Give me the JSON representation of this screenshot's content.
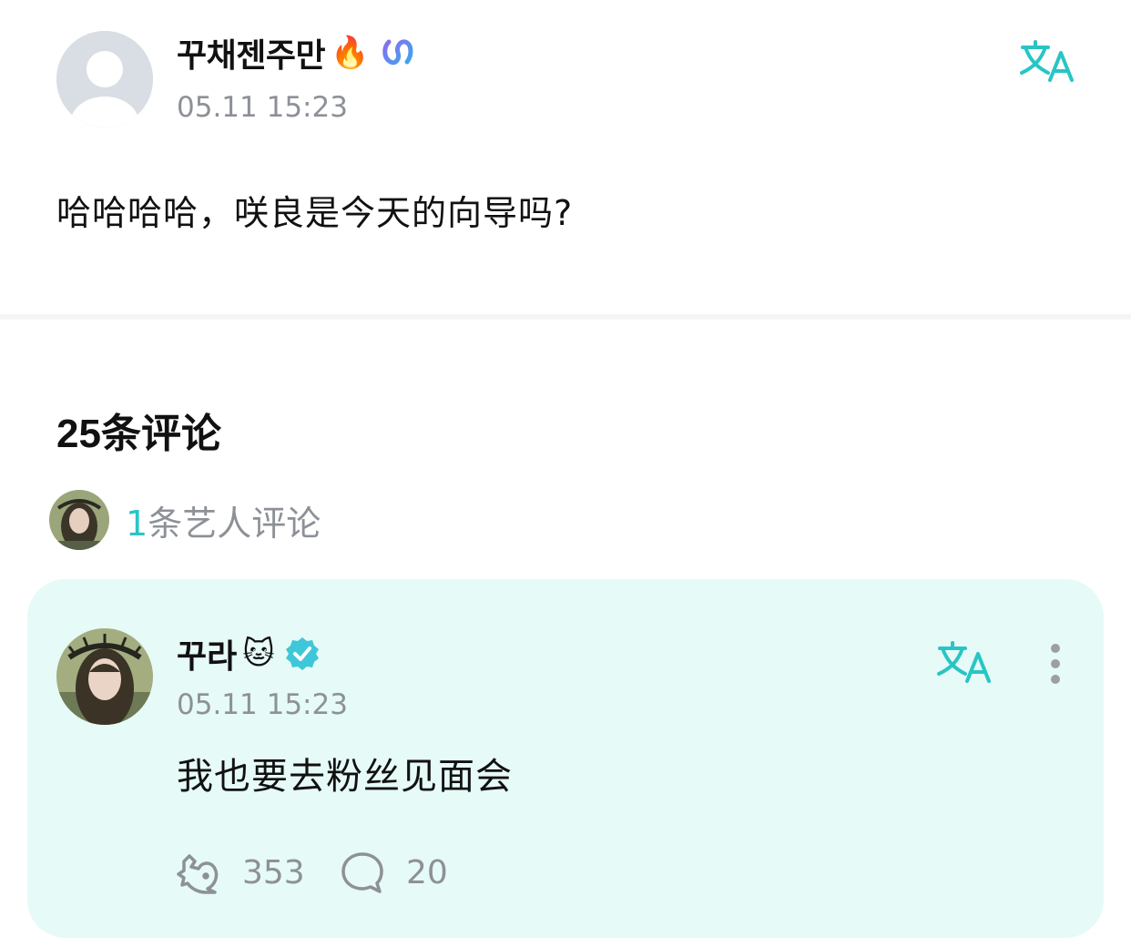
{
  "post": {
    "author": {
      "name": "꾸채젠주만",
      "emoji": "🔥",
      "badge": "weverse-badge-icon"
    },
    "time": "05.11 15:23",
    "content": "哈哈哈哈，咲良是今天的向导吗?",
    "translate_icon": "translate-icon"
  },
  "comments": {
    "count_number": "25",
    "count_label": "条评论",
    "artist_summary": {
      "count": "1",
      "label": "条艺人评论"
    }
  },
  "artist_comment": {
    "author": {
      "name": "꾸라",
      "emoji": "🐱",
      "badge": "verified-badge-icon"
    },
    "time": "05.11 15:23",
    "text": "我也要去粉丝见面会",
    "likes": "353",
    "replies": "20",
    "icons": [
      "translate-icon",
      "more-icon",
      "like-icon",
      "reply-icon"
    ]
  },
  "colors": {
    "accent": "#29c5c5",
    "card_bg": "#e6faf7",
    "muted_text": "#8d9197"
  }
}
